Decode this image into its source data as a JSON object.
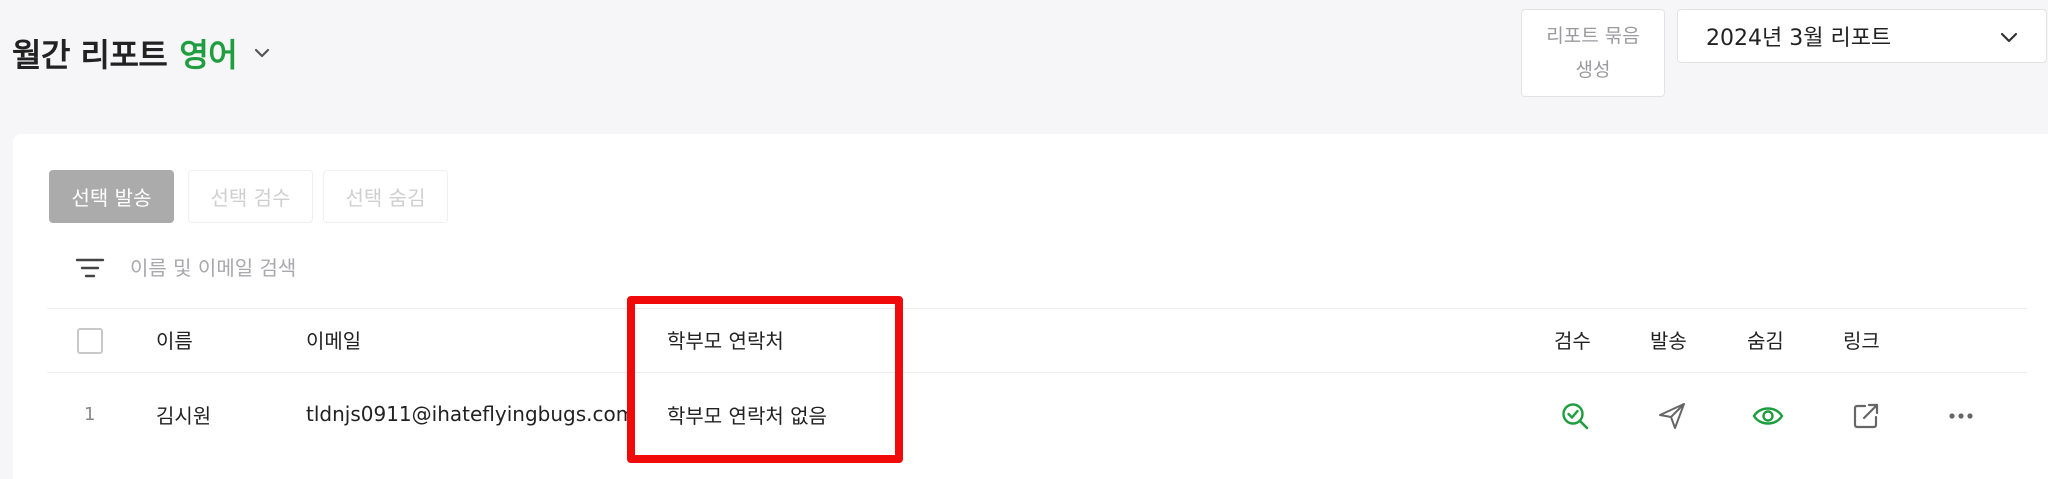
{
  "header": {
    "title": "월간 리포트",
    "subject": "영어",
    "bundle_button_line1": "리포트 묶음",
    "bundle_button_line2": "생성",
    "month_select_value": "2024년 3월 리포트"
  },
  "actions": {
    "send_selected": "선택 발송",
    "review_selected": "선택 검수",
    "hide_selected": "선택 숨김"
  },
  "search": {
    "placeholder": "이름 및 이메일 검색",
    "value": ""
  },
  "table": {
    "columns": {
      "name": "이름",
      "email": "이메일",
      "parent_contact": "학부모 연락처",
      "review": "검수",
      "send": "발송",
      "hide": "숨김",
      "link": "링크"
    },
    "rows": [
      {
        "index": "1",
        "name": "김시원",
        "email": "tldnjs0911@ihateflyingbugs.com",
        "parent_contact": "학부모 연락처 없음"
      }
    ]
  },
  "colors": {
    "accent_green": "#1f9d3f",
    "highlight_red": "#f00a0a"
  },
  "icons": [
    "chevron-down-icon",
    "filter-icon",
    "search-check-icon",
    "send-icon",
    "eye-icon",
    "external-link-icon",
    "more-icon"
  ]
}
